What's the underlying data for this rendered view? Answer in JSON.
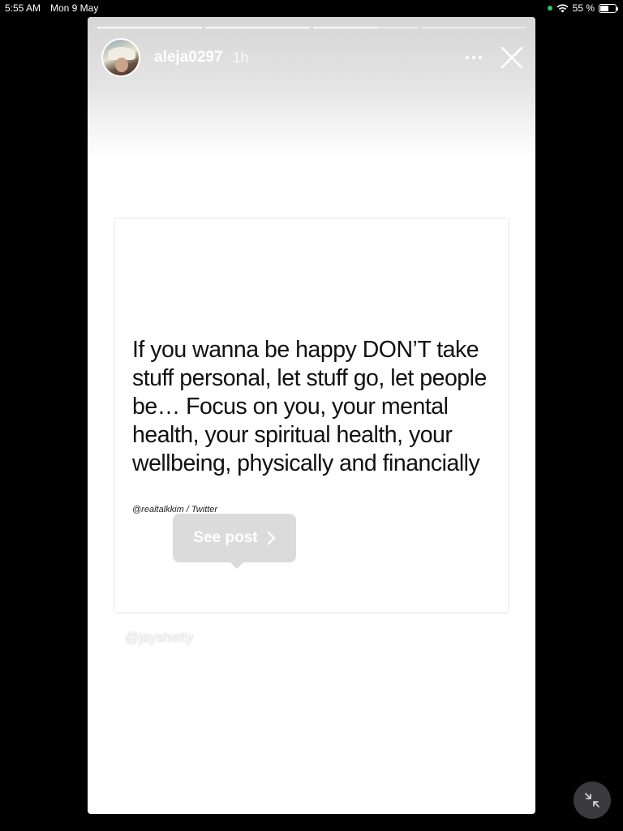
{
  "status_bar": {
    "time": "5:55 AM",
    "date": "Mon 9 May",
    "battery_text": "55 %",
    "battery_level": 0.55,
    "indicator_color": "#34c759"
  },
  "story": {
    "progress_segments": [
      1,
      1,
      0.62,
      0
    ],
    "username": "aleja0297",
    "age": "1h",
    "more_icon": "more-horizontal-icon",
    "close_icon": "close-icon"
  },
  "post": {
    "quote": "If you wanna be happy DON’T take stuff personal, let stuff go, let people be… Focus on you, your mental health, your spiritual health, your wellbeing, physically and financially",
    "attribution": "@realtalkkim / Twitter",
    "see_post_label": "See post",
    "credit": "@jayshetty"
  },
  "controls": {
    "minimize_icon": "minimize-arrows-icon"
  }
}
